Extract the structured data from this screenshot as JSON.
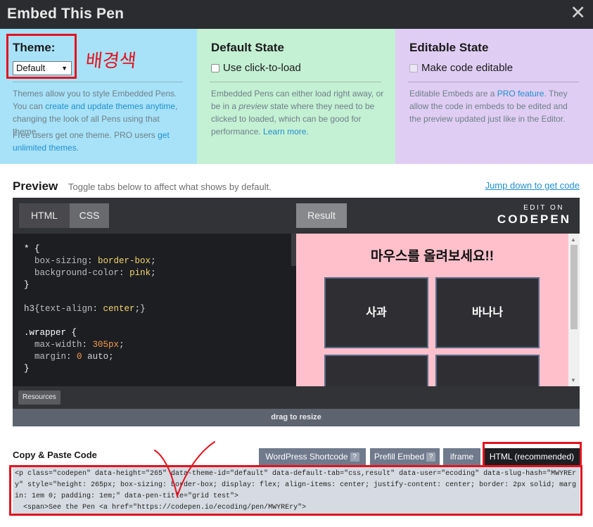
{
  "header": {
    "title": "Embed This Pen",
    "close_glyph": "✕"
  },
  "settings": {
    "theme": {
      "heading": "Theme:",
      "selected": "Default",
      "annotation": "배경색",
      "desc1_a": "Themes allow you to style Embedded Pens. You can ",
      "desc1_link": "create and update themes anytime",
      "desc1_b": ", changing the look of all Pens using that theme.",
      "desc2_a": "Free users get one theme. PRO users ",
      "desc2_link": "get unlimited themes",
      "desc2_b": "."
    },
    "default_state": {
      "heading": "Default State",
      "checkbox_label": "Use click-to-load",
      "desc_a": "Embedded Pens can either load right away, or be in a ",
      "desc_em": "preview",
      "desc_b": " state where they need to be clicked to loaded, which can be good for performance. ",
      "desc_link": "Learn more."
    },
    "editable_state": {
      "heading": "Editable State",
      "checkbox_label": "Make code editable",
      "desc_a": "Editable Embeds are a ",
      "desc_link": "PRO feature",
      "desc_b": ". They allow the code in embeds to be edited and the preview updated just like in the Editor."
    }
  },
  "preview": {
    "title": "Preview",
    "hint": "Toggle tabs below to affect what shows by default.",
    "jump_link": "Jump down to get code",
    "tabs": {
      "html": "HTML",
      "css": "CSS",
      "result": "Result"
    },
    "logo": {
      "edit_on": "EDIT ON",
      "brand": "CODEPEN"
    },
    "css_code": "* {\n  box-sizing: border-box;\n  background-color: pink;\n}\n\nh3{text-align: center;}\n\n.wrapper {\n  max-width: 305px;\n  margin: 0 auto;\n}",
    "result": {
      "heading": "마우스를 올려보세요!!",
      "items": [
        "사과",
        "바나나",
        "",
        ""
      ]
    },
    "resources_button": "Resources",
    "drag_label": "drag to resize"
  },
  "copy": {
    "title": "Copy & Paste Code",
    "tabs": {
      "wordpress": "WordPress Shortcode",
      "prefill": "Prefill Embed",
      "iframe": "iframe",
      "html": "HTML (recommended)",
      "help_glyph": "?"
    },
    "code": "<p class=\"codepen\" data-height=\"265\" data-theme-id=\"default\" data-default-tab=\"css,result\" data-user=\"ecoding\" data-slug-hash=\"MWYREry\" style=\"height: 265px; box-sizing: border-box; display: flex; align-items: center; justify-content: center; border: 2px solid; margin: 1em 0; padding: 1em;\" data-pen-title=\"grid test\">\n  <span>See the Pen <a href=\"https://codepen.io/ecoding/pen/MWYREry\">"
  },
  "colors": {
    "topbar": "#2b2c30",
    "theme_panel": "#a8e2f8",
    "default_panel": "#c4f0d4",
    "editable_panel": "#e0cdf3",
    "link": "#1f8fd0",
    "annotation_red": "#e3131e",
    "result_bg": "#ffc0cb"
  }
}
